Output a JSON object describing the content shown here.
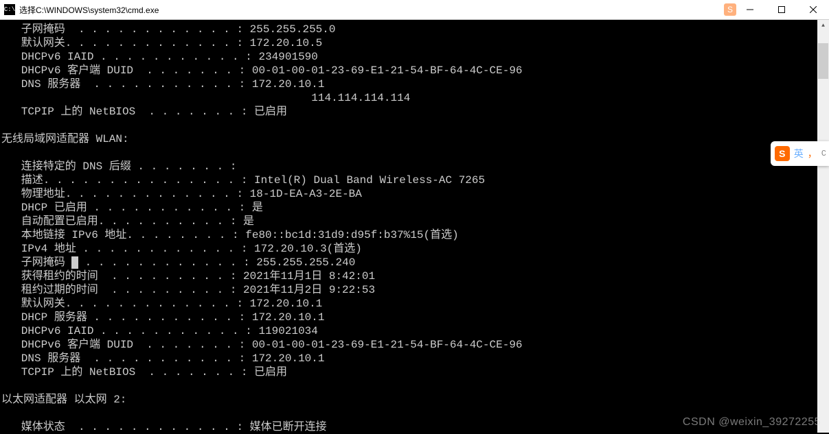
{
  "window": {
    "icon_label": "C:\\",
    "title": "选择C:\\WINDOWS\\system32\\cmd.exe"
  },
  "badge": {
    "icon_letter": "S",
    "label": "英",
    "comma": "，",
    "tail": "C"
  },
  "terminal": {
    "block1": [
      {
        "label": "子网掩码",
        "dots": "  . . . . . . . . . . . . ",
        "value": "255.255.255.0"
      },
      {
        "label": "默认网关",
        "dots": ". . . . . . . . . . . . . ",
        "value": "172.20.10.5"
      },
      {
        "label": "DHCPv6 IAID",
        "dots": " . . . . . . . . . . . ",
        "value": "234901590"
      },
      {
        "label": "DHCPv6 客户端 DUID",
        "dots": "  . . . . . . . ",
        "value": "00-01-00-01-23-69-E1-21-54-BF-64-4C-CE-96"
      },
      {
        "label": "DNS 服务器",
        "dots": "  . . . . . . . . . . . ",
        "value": "172.20.10.1"
      },
      {
        "label": "",
        "dots": "",
        "value": "114.114.114.114",
        "cont": true
      },
      {
        "label": "TCPIP 上的 NetBIOS",
        "dots": "  . . . . . . . ",
        "value": "已启用"
      }
    ],
    "header_wlan": "无线局域网适配器 WLAN:",
    "block2": [
      {
        "label": "连接特定的 DNS 后缀",
        "dots": " . . . . . . . ",
        "value": ""
      },
      {
        "label": "描述",
        "dots": ". . . . . . . . . . . . . . . ",
        "value": "Intel(R) Dual Band Wireless-AC 7265"
      },
      {
        "label": "物理地址",
        "dots": ". . . . . . . . . . . . . ",
        "value": "18-1D-EA-A3-2E-BA"
      },
      {
        "label": "DHCP 已启用",
        "dots": " . . . . . . . . . . . ",
        "value": "是"
      },
      {
        "label": "自动配置已启用",
        "dots": ". . . . . . . . . . ",
        "value": "是"
      },
      {
        "label": "本地链接 IPv6 地址",
        "dots": ". . . . . . . . ",
        "value": "fe80::bc1d:31d9:d95f:b37%15(首选)"
      },
      {
        "label": "IPv4 地址",
        "dots": " . . . . . . . . . . . . ",
        "value": "172.20.10.3(首选)"
      },
      {
        "label": "子网掩码",
        "dots": "  . . . . . . . . . . . . ",
        "value": "255.255.255.240",
        "cursor_after_label": true
      },
      {
        "label": "获得租约的时间",
        "dots": "  . . . . . . . . . ",
        "value": "2021年11月1日 8:42:01"
      },
      {
        "label": "租约过期的时间",
        "dots": "  . . . . . . . . . ",
        "value": "2021年11月2日 9:22:53"
      },
      {
        "label": "默认网关",
        "dots": ". . . . . . . . . . . . . ",
        "value": "172.20.10.1"
      },
      {
        "label": "DHCP 服务器",
        "dots": " . . . . . . . . . . . ",
        "value": "172.20.10.1"
      },
      {
        "label": "DHCPv6 IAID",
        "dots": " . . . . . . . . . . . ",
        "value": "119021034"
      },
      {
        "label": "DHCPv6 客户端 DUID",
        "dots": "  . . . . . . . ",
        "value": "00-01-00-01-23-69-E1-21-54-BF-64-4C-CE-96"
      },
      {
        "label": "DNS 服务器",
        "dots": "  . . . . . . . . . . . ",
        "value": "172.20.10.1"
      },
      {
        "label": "TCPIP 上的 NetBIOS",
        "dots": "  . . . . . . . ",
        "value": "已启用"
      }
    ],
    "header_eth2": "以太网适配器 以太网 2:",
    "block3": [
      {
        "label": "媒体状态",
        "dots": "  . . . . . . . . . . . . ",
        "value": "媒体已断开连接"
      }
    ]
  },
  "watermark": "CSDN @weixin_39272255"
}
